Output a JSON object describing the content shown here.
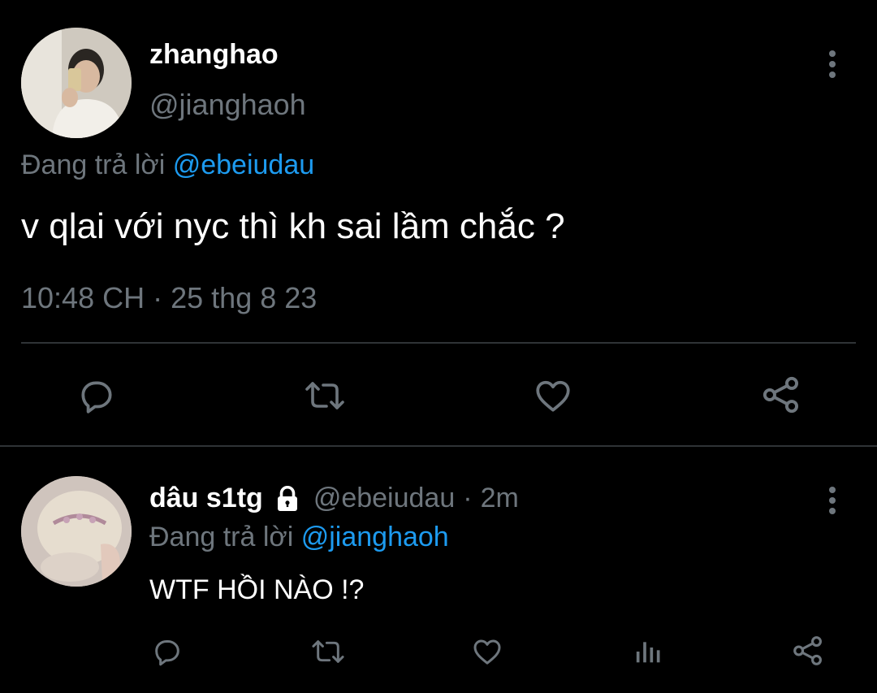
{
  "main_tweet": {
    "display_name": "zhanghao",
    "handle": "@jianghaoh",
    "replying_prefix": "Đang trả lời",
    "replying_to": "@ebeiudau",
    "text": "v qlai với nyc thì kh sai lầm chắc ?",
    "time": "10:48 CH",
    "separator": "·",
    "date": "25 thg 8 23",
    "actions": [
      "reply-icon",
      "retweet-icon",
      "like-icon",
      "share-icon"
    ]
  },
  "reply_tweet": {
    "display_name": "dâu s1tg",
    "handle": "@ebeiudau",
    "separator": "·",
    "age": "2m",
    "replying_prefix": "Đang trả lời",
    "replying_to": "@jianghaoh",
    "text": "WTF HỒI NÀO !?",
    "actions": [
      "reply-icon",
      "retweet-icon",
      "like-icon",
      "analytics-icon",
      "share-icon"
    ]
  },
  "colors": {
    "background": "#000000",
    "text": "#e7e9ea",
    "muted": "#6e767d",
    "link": "#1d9bf0",
    "divider": "#2f3336"
  }
}
